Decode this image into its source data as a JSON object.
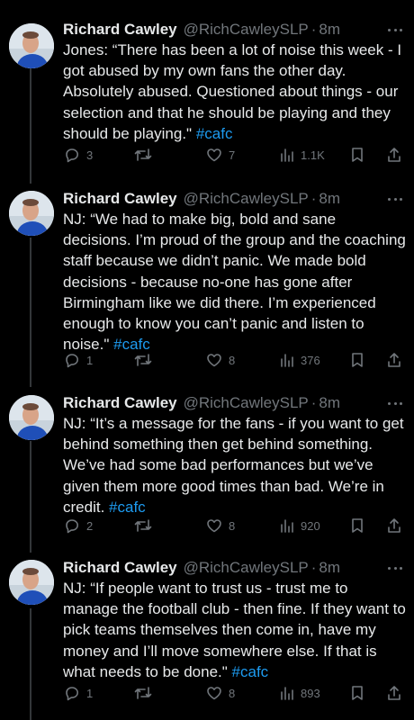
{
  "colors": {
    "background": "#000000",
    "text": "#e7e9ea",
    "muted": "#71767b",
    "link": "#1d9bf0"
  },
  "tweets": [
    {
      "author": {
        "name": "Richard Cawley",
        "handle": "@RichCawleySLP",
        "time": "8m"
      },
      "text": "Jones: “There has been a lot of noise this week - I got abused by my own fans the other day. Absolutely abused. Questioned about things - our selection and that he should be playing and they should be playing.\"",
      "hashtag": "#cafc",
      "stats": {
        "replies": "3",
        "retweets": "",
        "likes": "7",
        "views": "1.1K"
      }
    },
    {
      "author": {
        "name": "Richard Cawley",
        "handle": "@RichCawleySLP",
        "time": "8m"
      },
      "text": "NJ: “We had to make big, bold and sane decisions. I’m proud of the group and the coaching staff because we didn’t panic. We made bold decisions - because no-one has gone after Birmingham like we did there. I’m experienced enough to know you can’t panic and listen to noise.\"",
      "hashtag": "#cafc",
      "stats": {
        "replies": "1",
        "retweets": "",
        "likes": "8",
        "views": "376"
      }
    },
    {
      "author": {
        "name": "Richard Cawley",
        "handle": "@RichCawleySLP",
        "time": "8m"
      },
      "text": "NJ: “It’s a message for the fans - if you want to get behind something then get behind something. We’ve had some bad performances but we’ve given them more good times than bad. We’re in credit.",
      "hashtag": "#cafc",
      "stats": {
        "replies": "2",
        "retweets": "",
        "likes": "8",
        "views": "920"
      }
    },
    {
      "author": {
        "name": "Richard Cawley",
        "handle": "@RichCawleySLP",
        "time": "8m"
      },
      "text": "NJ: “If people want to trust us - trust me to manage the football club - then fine. If they want to pick teams themselves then come in, have my money and I’ll move somewhere else. If that is what needs to be done.\"",
      "hashtag": "#cafc",
      "stats": {
        "replies": "1",
        "retweets": "",
        "likes": "8",
        "views": "893"
      }
    }
  ],
  "icons": [
    "reply-icon",
    "retweet-icon",
    "like-icon",
    "views-icon",
    "bookmark-icon",
    "share-icon",
    "more-icon"
  ]
}
